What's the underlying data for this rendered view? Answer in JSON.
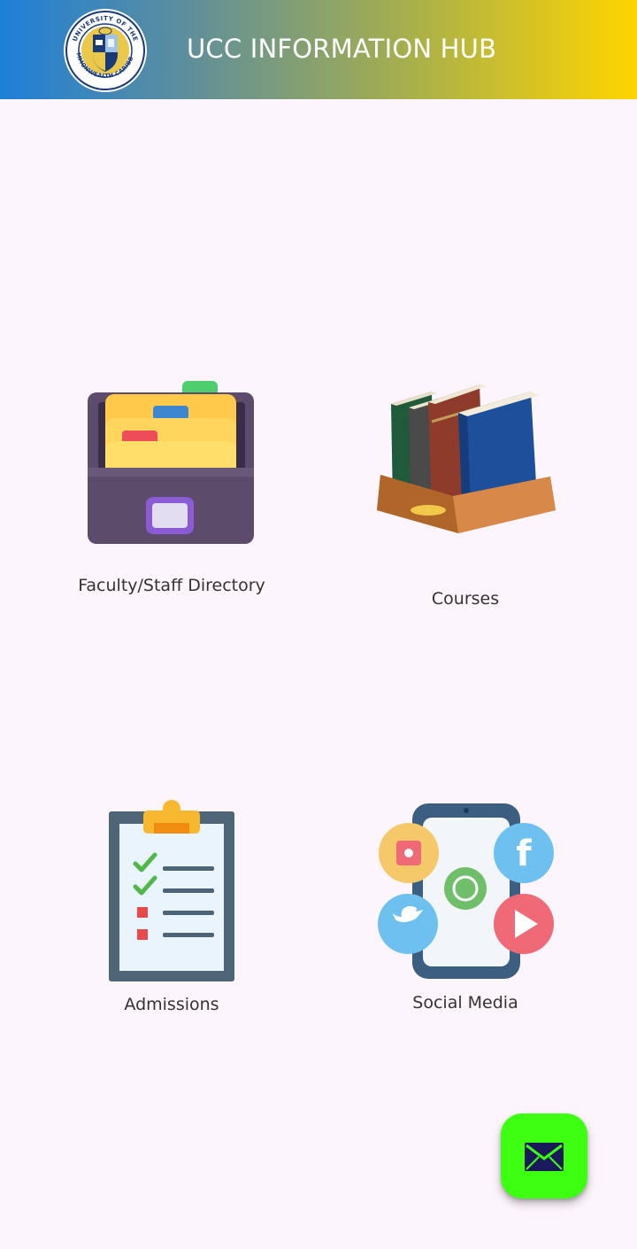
{
  "header": {
    "title": "UCC INFORMATION HUB",
    "logo_icon": "university-seal-logo"
  },
  "tiles": [
    {
      "label": "Faculty/Staff Directory",
      "icon": "file-cabinet-icon"
    },
    {
      "label": "Courses",
      "icon": "books-tray-icon"
    },
    {
      "label": "Admissions",
      "icon": "clipboard-checklist-icon"
    },
    {
      "label": "Social Media",
      "icon": "phone-social-media-icon"
    }
  ],
  "fab": {
    "icon": "mail-icon"
  },
  "colors": {
    "fab": "#3dff12",
    "background": "#fcf5fb",
    "header_start": "#1e7fd8",
    "header_end": "#ffd500"
  }
}
